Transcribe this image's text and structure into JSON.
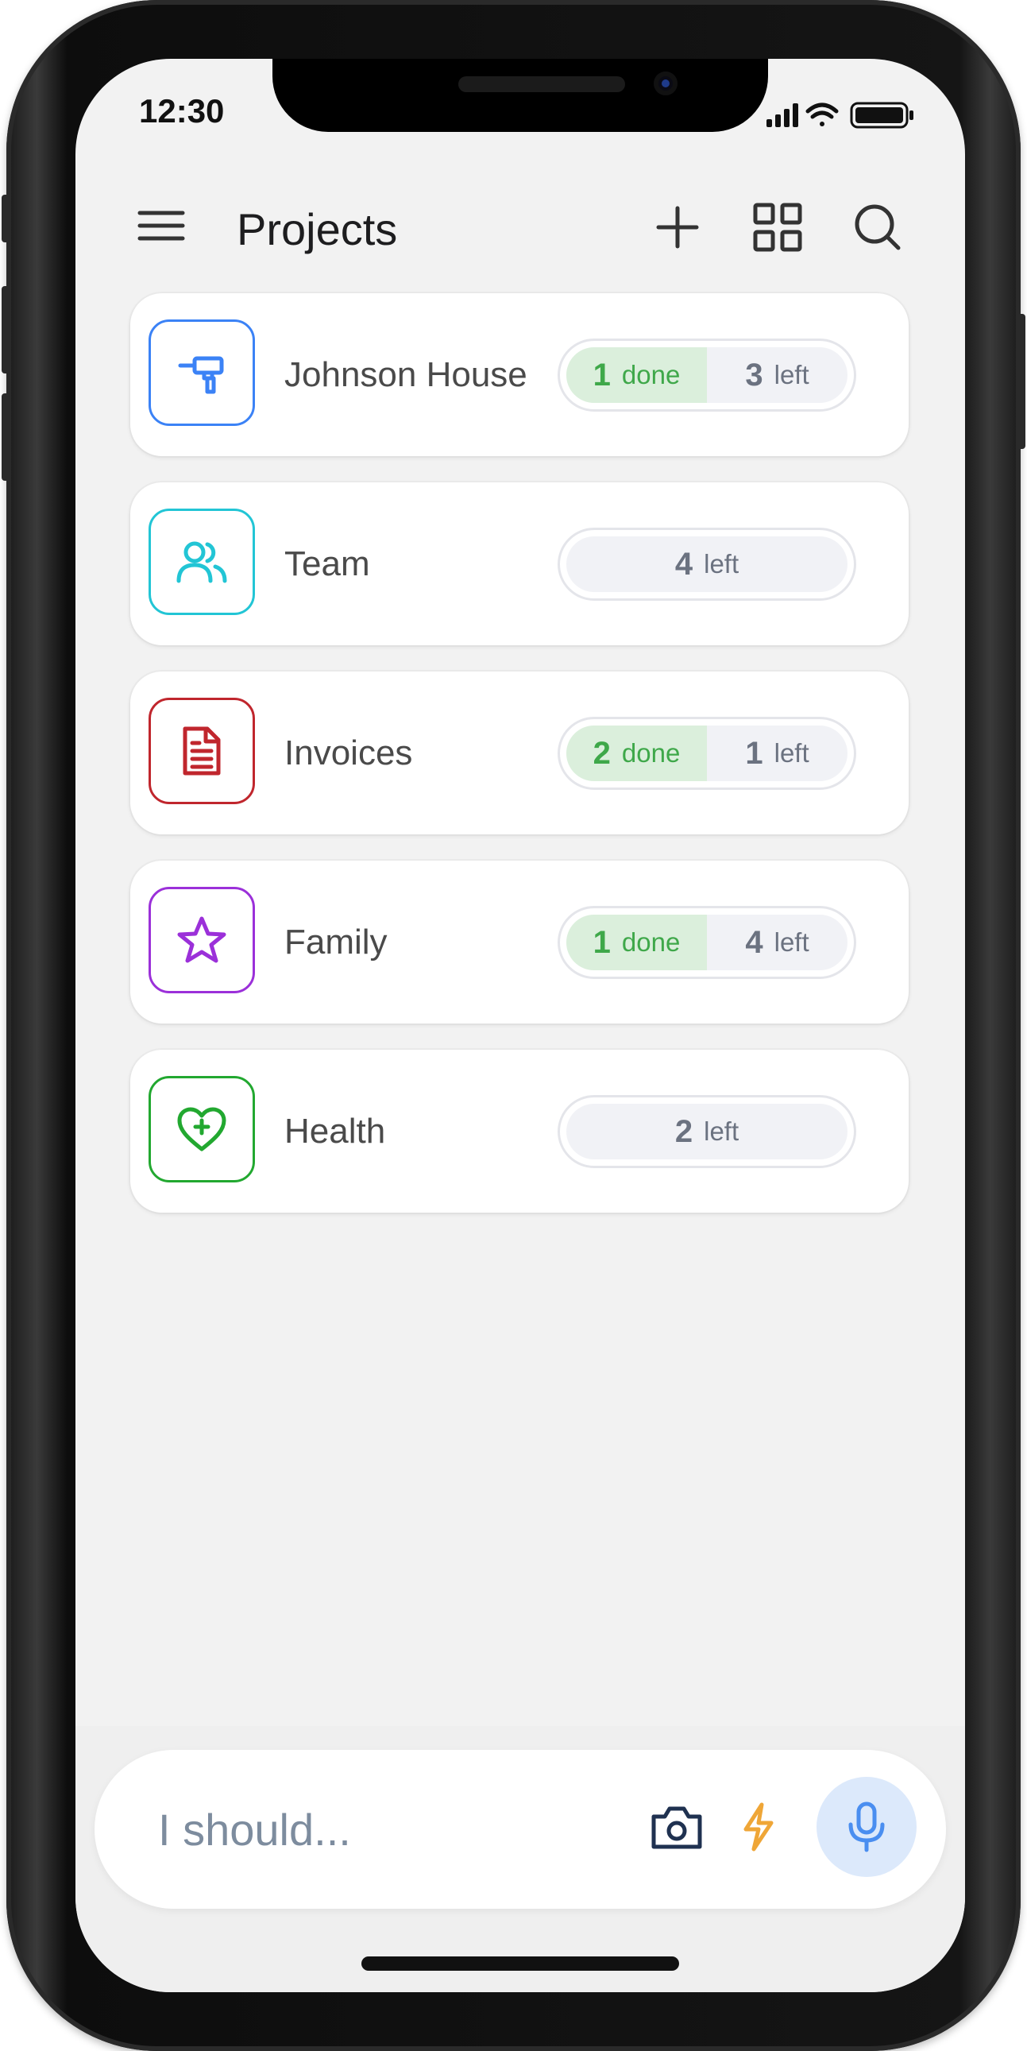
{
  "status_bar": {
    "time": "12:30"
  },
  "header": {
    "title": "Projects"
  },
  "icons": {
    "menu": "hamburger-menu-icon",
    "add": "plus-icon",
    "grid": "grid-icon",
    "search": "search-icon"
  },
  "projects": [
    {
      "name": "Johnson House",
      "icon": "paint-roller-icon",
      "color": "#3b82f6",
      "done_count": "1",
      "done_label": "done",
      "left_count": "3",
      "left_label": "left"
    },
    {
      "name": "Team",
      "icon": "users-icon",
      "color": "#22c5d5",
      "left_count": "4",
      "left_label": "left"
    },
    {
      "name": "Invoices",
      "icon": "document-icon",
      "color": "#c0262d",
      "done_count": "2",
      "done_label": "done",
      "left_count": "1",
      "left_label": "left"
    },
    {
      "name": "Family",
      "icon": "star-icon",
      "color": "#9b30d9",
      "done_count": "1",
      "done_label": "done",
      "left_count": "4",
      "left_label": "left"
    },
    {
      "name": "Health",
      "icon": "heart-plus-icon",
      "color": "#22a830",
      "left_count": "2",
      "left_label": "left"
    }
  ],
  "composer": {
    "placeholder": "I should...",
    "camera_icon": "camera-icon",
    "lightning_icon": "lightning-icon",
    "mic_icon": "microphone-icon",
    "accent": "#4a8ef0"
  }
}
